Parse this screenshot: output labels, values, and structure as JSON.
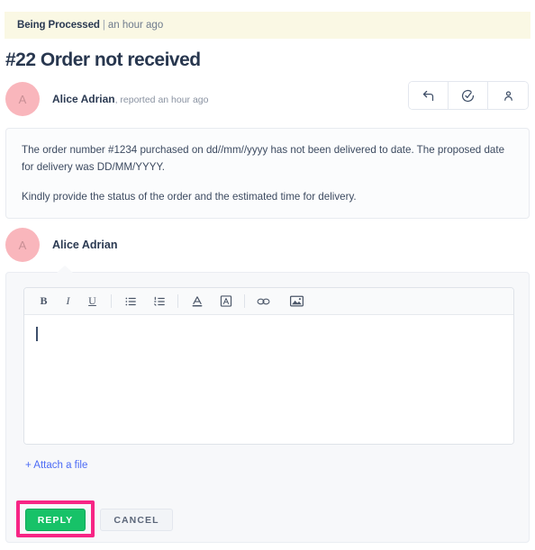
{
  "status_banner": {
    "state": "Being Processed",
    "separator": "|",
    "time": "an hour ago"
  },
  "ticket": {
    "title": "#22 Order not received"
  },
  "reporter": {
    "avatar_initial": "A",
    "name": "Alice Adrian",
    "action": ", reported an hour ago"
  },
  "actions": {
    "reply": "reply-icon",
    "resolve": "check-circle-icon",
    "assign": "person-icon"
  },
  "message": {
    "paragraph1": "The order number #1234 purchased on dd//mm//yyyy has not been delivered to date. The proposed date for delivery was DD/MM/YYYY.",
    "paragraph2": "Kindly provide the status of the order and the estimated time for delivery."
  },
  "responder": {
    "avatar_initial": "A",
    "name": "Alice Adrian"
  },
  "editor": {
    "toolbar": [
      {
        "name": "bold-icon",
        "label": "B"
      },
      {
        "name": "italic-icon",
        "label": "I"
      },
      {
        "name": "underline-icon",
        "label": "U"
      },
      {
        "name": "bullet-list-icon",
        "label": ""
      },
      {
        "name": "numbered-list-icon",
        "label": ""
      },
      {
        "name": "text-color-icon",
        "label": "A"
      },
      {
        "name": "highlight-color-icon",
        "label": "A"
      },
      {
        "name": "link-icon",
        "label": ""
      },
      {
        "name": "image-icon",
        "label": ""
      }
    ],
    "content": "",
    "placeholder": ""
  },
  "attach": {
    "label": "+ Attach a file"
  },
  "footer": {
    "reply_label": "REPLY",
    "cancel_label": "CANCEL"
  },
  "colors": {
    "banner_bg": "#faf8e4",
    "avatar_bg": "#f9b6bc",
    "reply_green": "#17c268",
    "highlight_pink": "#f72585",
    "link_blue": "#4d6cf5"
  }
}
